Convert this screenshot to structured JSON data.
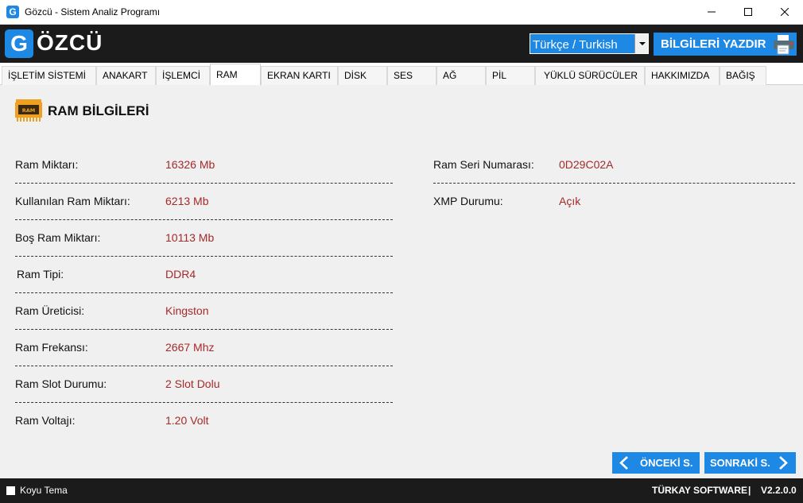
{
  "window": {
    "title": "Gözcü - Sistem Analiz Programı",
    "icon_letter": "G"
  },
  "header": {
    "logo_letter": "G",
    "logo_word": "ÖZCÜ",
    "language_value": "Türkçe / Turkish",
    "print_label": "BİLGİLERİ YAZDIR",
    "accent_color": "#1e88e5"
  },
  "tabs": [
    {
      "label": "İŞLETİM SİSTEMİ"
    },
    {
      "label": "ANAKART"
    },
    {
      "label": "İŞLEMCİ"
    },
    {
      "label": "RAM"
    },
    {
      "label": "EKRAN KARTI"
    },
    {
      "label": "DİSK"
    },
    {
      "label": "SES"
    },
    {
      "label": "AĞ"
    },
    {
      "label": "PİL"
    },
    {
      "label": "YÜKLÜ SÜRÜCÜLER"
    },
    {
      "label": "HAKKIMIZDA"
    },
    {
      "label": "BAĞIŞ"
    }
  ],
  "active_tab": "RAM",
  "section": {
    "title": "RAM BİLGİLERİ",
    "icon_text": "RAM"
  },
  "left_rows": [
    {
      "label": "Ram Miktarı:",
      "value": "16326 Mb"
    },
    {
      "label": "Kullanılan Ram Miktarı:",
      "value": "6213 Mb"
    },
    {
      "label": "Boş Ram Miktarı:",
      "value": "10113 Mb"
    },
    {
      "label": "Ram Tipi:",
      "value": "DDR4"
    },
    {
      "label": "Ram Üreticisi:",
      "value": "Kingston"
    },
    {
      "label": "Ram Frekansı:",
      "value": "2667 Mhz"
    },
    {
      "label": "Ram Slot Durumu:",
      "value": "2 Slot Dolu"
    },
    {
      "label": "Ram Voltajı:",
      "value": "1.20 Volt"
    }
  ],
  "right_rows": [
    {
      "label": "Ram Seri Numarası:",
      "value": "0D29C02A"
    },
    {
      "label": "XMP Durumu:",
      "value": "Açık"
    }
  ],
  "nav": {
    "prev_label": "ÖNCEKİ S.",
    "next_label": "SONRAKİ S."
  },
  "footer": {
    "dark_theme_label": "Koyu Tema",
    "company": "TÜRKAY SOFTWARE",
    "separator": "|",
    "version": "V2.2.0.0"
  }
}
